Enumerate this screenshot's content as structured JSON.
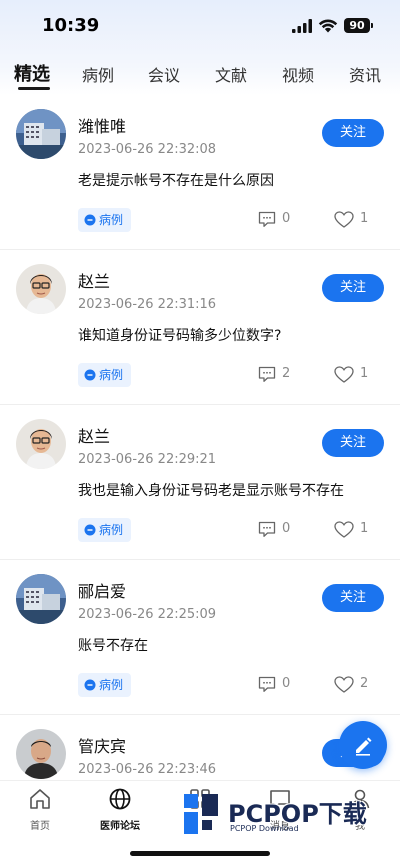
{
  "status_bar": {
    "time": "10:39",
    "battery": "90"
  },
  "tabs": [
    {
      "label": "精选",
      "active": true
    },
    {
      "label": "病例",
      "active": false
    },
    {
      "label": "会议",
      "active": false
    },
    {
      "label": "文献",
      "active": false
    },
    {
      "label": "视频",
      "active": false
    },
    {
      "label": "资讯",
      "active": false
    }
  ],
  "posts": [
    {
      "author": "潍惟唯",
      "time": "2023-06-26 22:32:08",
      "content": "老是提示帐号不存在是什么原因",
      "follow_label": "关注",
      "tag": "病例",
      "comments": "0",
      "likes": "1",
      "avatar_type": "building"
    },
    {
      "author": "赵兰",
      "time": "2023-06-26 22:31:16",
      "content": "谁知道身份证号码输多少位数字?",
      "follow_label": "关注",
      "tag": "病例",
      "comments": "2",
      "likes": "1",
      "avatar_type": "person"
    },
    {
      "author": "赵兰",
      "time": "2023-06-26 22:29:21",
      "content": "我也是输入身份证号码老是显示账号不存在",
      "follow_label": "关注",
      "tag": "病例",
      "comments": "0",
      "likes": "1",
      "avatar_type": "person"
    },
    {
      "author": "郦启爱",
      "time": "2023-06-26 22:25:09",
      "content": "账号不存在",
      "follow_label": "关注",
      "tag": "病例",
      "comments": "0",
      "likes": "2",
      "avatar_type": "building"
    },
    {
      "author": "管庆宾",
      "time": "2023-06-26 22:23:46",
      "content": "",
      "follow_label": "关注",
      "tag": "",
      "comments": "",
      "likes": "",
      "avatar_type": "person2"
    }
  ],
  "bottom_nav": [
    {
      "label": "首页",
      "icon": "home-icon",
      "active": false
    },
    {
      "label": "医师论坛",
      "icon": "globe-icon",
      "active": true
    },
    {
      "label": "",
      "icon": "grid-icon",
      "active": false
    },
    {
      "label": "消息",
      "icon": "message-icon",
      "active": false
    },
    {
      "label": "我",
      "icon": "user-icon",
      "active": false
    }
  ],
  "watermark": {
    "title": "PCPOP下载",
    "subtitle": "PCPOP Download"
  },
  "colors": {
    "accent": "#1b74ef",
    "tag_bg": "#eaf2fe"
  }
}
